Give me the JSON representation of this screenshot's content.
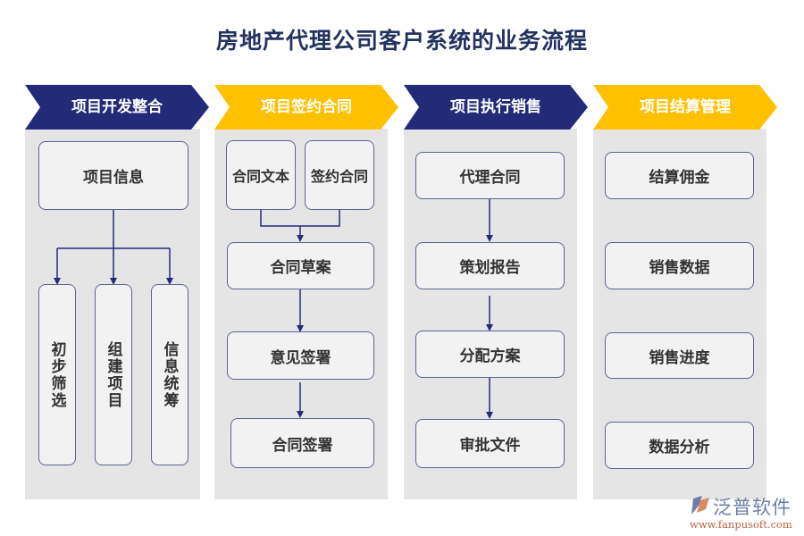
{
  "title": "房地产代理公司客户系统的业务流程",
  "colors": {
    "navy": "#232b79",
    "yellow": "#ffc000",
    "panel": "#e5e5e5",
    "box_fill": "#f2f2f2",
    "box_border": "#5b6594",
    "title": "#23325f"
  },
  "stages": [
    {
      "label": "项目开发整合",
      "color": "navy",
      "nodes": {
        "top": "项目信息",
        "children": [
          "初步筛选",
          "组建项目",
          "信息统筹"
        ]
      }
    },
    {
      "label": "项目签约合同",
      "color": "yellow",
      "nodes": {
        "top_left": "合同文本",
        "top_right": "签约合同",
        "steps": [
          "合同草案",
          "意见签署",
          "合同签署"
        ]
      }
    },
    {
      "label": "项目执行销售",
      "color": "navy",
      "nodes": {
        "steps": [
          "代理合同",
          "策划报告",
          "分配方案",
          "审批文件"
        ]
      }
    },
    {
      "label": "项目结算管理",
      "color": "yellow",
      "nodes": {
        "items": [
          "结算佣金",
          "销售数据",
          "销售进度",
          "数据分析"
        ]
      }
    }
  ],
  "logo": {
    "name": "泛普软件",
    "url": "www.fanpusoft.com"
  }
}
